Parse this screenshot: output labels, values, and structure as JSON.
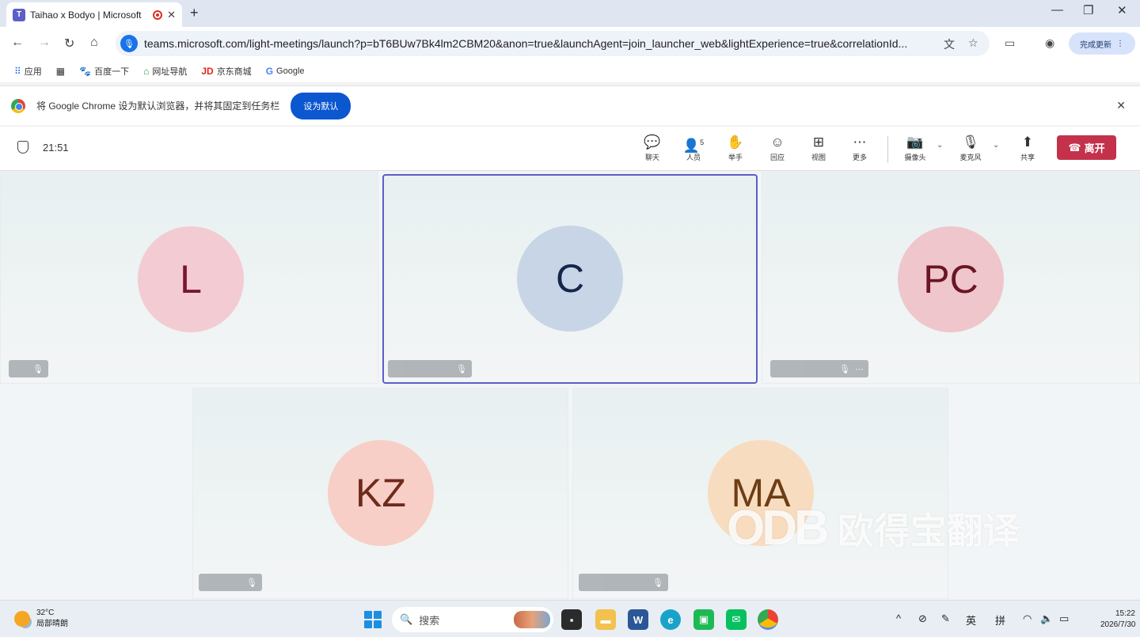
{
  "browser": {
    "tab_title": "Taihao x Bodyo | Microsoft",
    "url": "teams.microsoft.com/light-meetings/launch?p=bT6BUw7Bk4lm2CBM20&anon=true&launchAgent=join_launcher_web&lightExperience=true&correlationId...",
    "update_label": "完成更新",
    "bookmarks": [
      "应用",
      "百度一下",
      "网址导航",
      "京东商城",
      "Google"
    ],
    "infobar_text": "将 Google Chrome 设为默认浏览器，并将其固定到任务栏",
    "set_default_label": "设为默认"
  },
  "meeting": {
    "time": "21:51",
    "people_count": "5",
    "controls": {
      "chat": "聊天",
      "people": "人员",
      "raise": "举手",
      "react": "回应",
      "view": "视图",
      "more": "更多",
      "camera": "摄像头",
      "mic": "麦克风",
      "share": "共享"
    },
    "leave_label": "离开",
    "participants": [
      {
        "initials": "L",
        "bg": "#f3cbd3",
        "fg": "#7a1530"
      },
      {
        "initials": "C",
        "bg": "#c8d5e6",
        "fg": "#14264b"
      },
      {
        "initials": "PC",
        "bg": "#efc6cc",
        "fg": "#6b1525"
      },
      {
        "initials": "KZ",
        "bg": "#f7cfc7",
        "fg": "#6f2a1c"
      },
      {
        "initials": "MA",
        "bg": "#f8dcc0",
        "fg": "#6d3d14"
      }
    ],
    "active_speaker": "C"
  },
  "watermark": {
    "logo": "ODB",
    "text": "欧得宝翻译"
  },
  "taskbar": {
    "weather_temp": "32°C",
    "weather_desc": "局部晴朗",
    "search_label": "搜索",
    "ime_lang": "英",
    "ime_mode": "拼",
    "time": "15:22",
    "date": "2026/7/30"
  }
}
